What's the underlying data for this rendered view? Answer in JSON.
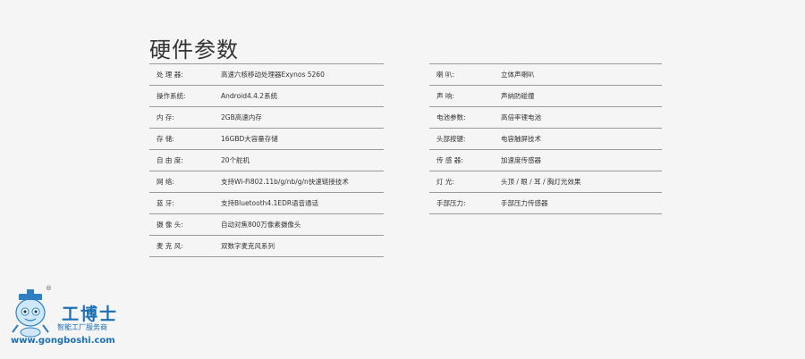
{
  "page": {
    "title": "硬件参数"
  },
  "left_specs": [
    {
      "label": "处 理 器:",
      "value": "高速六核移动处理器Exynos 5260"
    },
    {
      "label": "操作系统:",
      "value": "Android4.4.2系统"
    },
    {
      "label": "内    存:",
      "value": "2GB高速内存"
    },
    {
      "label": "存    储:",
      "value": "16GBD大容量存储"
    },
    {
      "label": "自 由 度:",
      "value": "20个舵机"
    },
    {
      "label": "网    络:",
      "value": "支持Wi-Fi802.11b/g/nb/g/n快速链接技术"
    },
    {
      "label": "蓝    牙:",
      "value": "支持Bluetooth4.1EDR语音通话"
    },
    {
      "label": "摄 像 头:",
      "value": "自动对焦800万像素摄像头"
    },
    {
      "label": "麦 克 风:",
      "value": "双数字麦克风系列"
    }
  ],
  "right_specs": [
    {
      "label": "喇    叭:",
      "value": "立体声喇叭"
    },
    {
      "label": "声    响:",
      "value": "声纳防碰撞"
    },
    {
      "label": "电池参数:",
      "value": "高倍率锂电池"
    },
    {
      "label": "头部按键:",
      "value": "电容触屏技术"
    },
    {
      "label": "传 感 器:",
      "value": "加速度传感器"
    },
    {
      "label": "灯    光:",
      "value": "头顶 / 眼 / 耳 / 胸灯光效果"
    },
    {
      "label": "手部压力:",
      "value": "手部压力传感器"
    }
  ],
  "watermark": {
    "brand": "工博士",
    "subtitle": "智能工厂服务商",
    "url": "www.gongboshi.com",
    "reg": "®"
  }
}
